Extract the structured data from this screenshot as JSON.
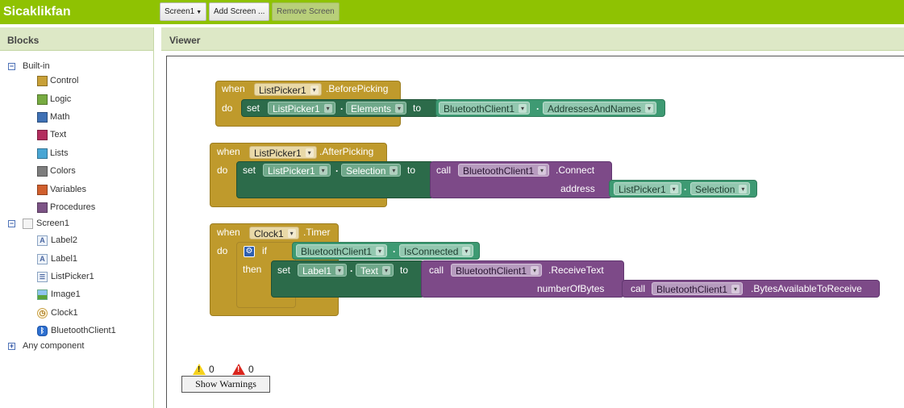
{
  "app": {
    "title": "Sicaklikfan"
  },
  "toolbar": {
    "screen_select": "Screen1",
    "add_screen": "Add Screen ...",
    "remove_screen": "Remove Screen"
  },
  "blocks_panel": {
    "header": "Blocks",
    "builtin_label": "Built-in",
    "builtin": [
      {
        "label": "Control",
        "color": "#c8a037"
      },
      {
        "label": "Logic",
        "color": "#77ab41"
      },
      {
        "label": "Math",
        "color": "#3f71b5"
      },
      {
        "label": "Text",
        "color": "#b32d5e"
      },
      {
        "label": "Lists",
        "color": "#49a6d4"
      },
      {
        "label": "Colors",
        "color": "#7d7d7d"
      },
      {
        "label": "Variables",
        "color": "#d05f2d"
      },
      {
        "label": "Procedures",
        "color": "#7c5385"
      }
    ],
    "screen_label": "Screen1",
    "components": [
      {
        "label": "Label2",
        "icon": "label-icon"
      },
      {
        "label": "Label1",
        "icon": "label-icon"
      },
      {
        "label": "ListPicker1",
        "icon": "listpicker-icon"
      },
      {
        "label": "Image1",
        "icon": "image-icon"
      },
      {
        "label": "Clock1",
        "icon": "clock-icon"
      },
      {
        "label": "BluetoothClient1",
        "icon": "bluetooth-icon"
      }
    ],
    "any_component": "Any component"
  },
  "viewer": {
    "header": "Viewer",
    "block1": {
      "when": "when",
      "component": "ListPicker1",
      "event": ".BeforePicking",
      "do": "do",
      "set": "set",
      "set_component": "ListPicker1",
      "set_property": "Elements",
      "to": "to",
      "value_component": "BluetoothClient1",
      "value_property": "AddressesAndNames"
    },
    "block2": {
      "when": "when",
      "component": "ListPicker1",
      "event": ".AfterPicking",
      "do": "do",
      "set": "set",
      "set_component": "ListPicker1",
      "set_property": "Selection",
      "to": "to",
      "call": "call",
      "call_component": "BluetoothClient1",
      "call_method": ".Connect",
      "param_label": "address",
      "param_component": "ListPicker1",
      "param_property": "Selection"
    },
    "block3": {
      "when": "when",
      "component": "Clock1",
      "event": ".Timer",
      "do": "do",
      "if": "if",
      "then": "then",
      "cond_component": "BluetoothClient1",
      "cond_property": "IsConnected",
      "set": "set",
      "set_component": "Label1",
      "set_property": "Text",
      "to": "to",
      "call": "call",
      "call_component": "BluetoothClient1",
      "call_method": ".ReceiveText",
      "param_label": "numberOfBytes",
      "inner_call": "call",
      "inner_component": "BluetoothClient1",
      "inner_method": ".BytesAvailableToReceive"
    },
    "warnings": {
      "warning_count": "0",
      "error_count": "0",
      "show_label": "Show Warnings"
    }
  }
}
